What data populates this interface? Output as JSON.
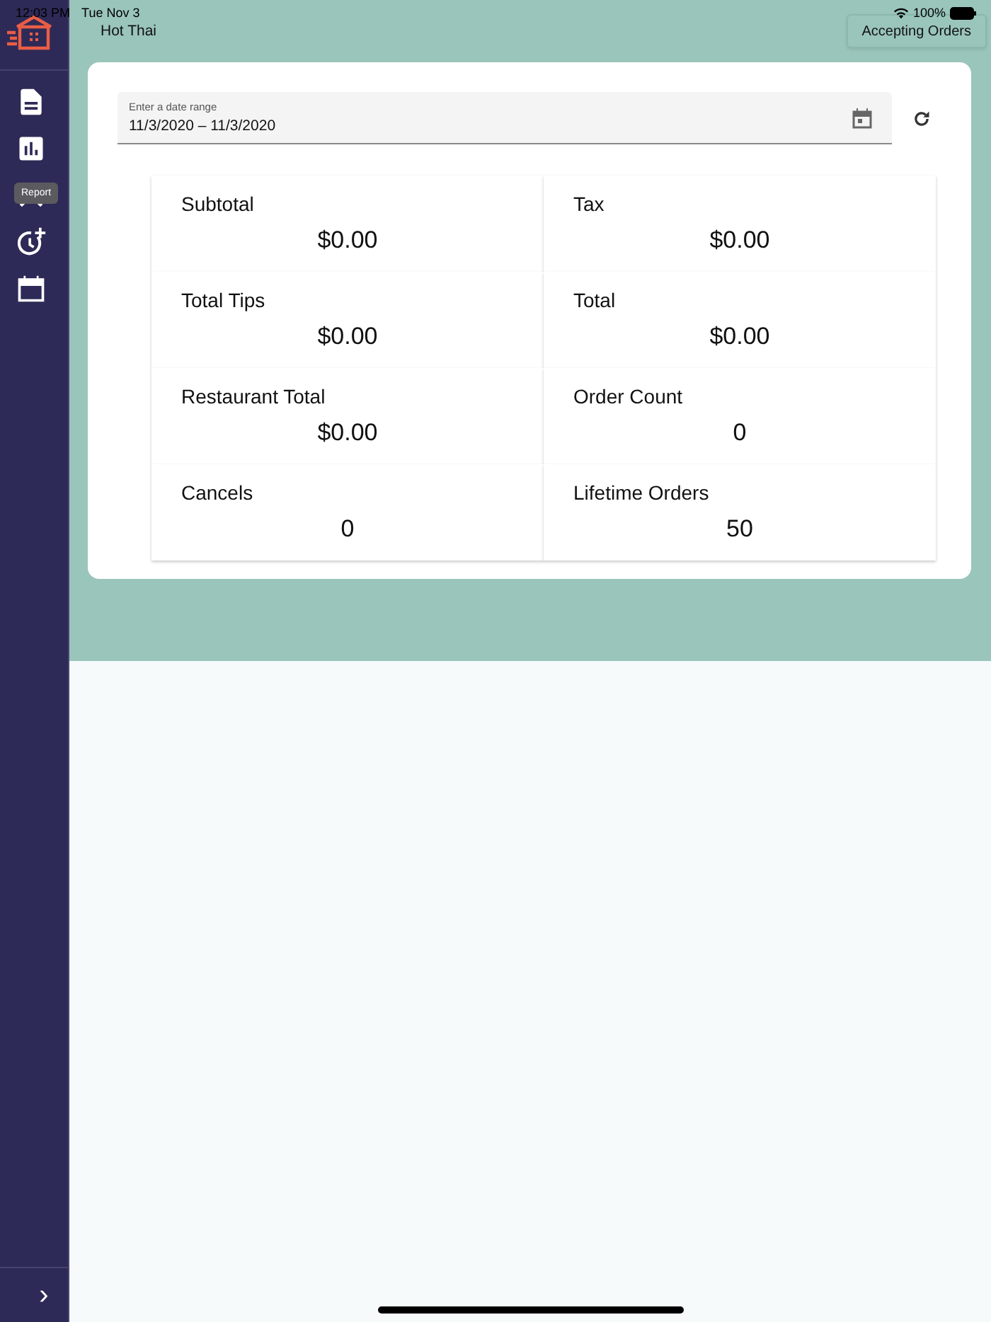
{
  "status_bar": {
    "time": "12:03 PM",
    "date": "Tue Nov 3",
    "battery": "100%"
  },
  "sidebar": {
    "items": [
      {
        "kind": "document",
        "selected": false
      },
      {
        "kind": "chart",
        "selected": false
      },
      {
        "kind": "tools",
        "selected": false,
        "tooltip": "Report"
      },
      {
        "kind": "timer-add",
        "selected": false
      },
      {
        "kind": "calendar",
        "selected": false
      }
    ],
    "expand": "›"
  },
  "header": {
    "restaurant": "Hot Thai",
    "status_button": "Accepting Orders"
  },
  "date_range": {
    "label": "Enter a date range",
    "value": "11/3/2020 – 11/3/2020"
  },
  "stats": [
    {
      "label": "Subtotal",
      "value": "$0.00"
    },
    {
      "label": "Tax",
      "value": "$0.00"
    },
    {
      "label": "Total Tips",
      "value": "$0.00"
    },
    {
      "label": "Total",
      "value": "$0.00"
    },
    {
      "label": "Restaurant Total",
      "value": "$0.00"
    },
    {
      "label": "Order Count",
      "value": "0"
    },
    {
      "label": "Cancels",
      "value": "0"
    },
    {
      "label": "Lifetime Orders",
      "value": "50"
    }
  ]
}
